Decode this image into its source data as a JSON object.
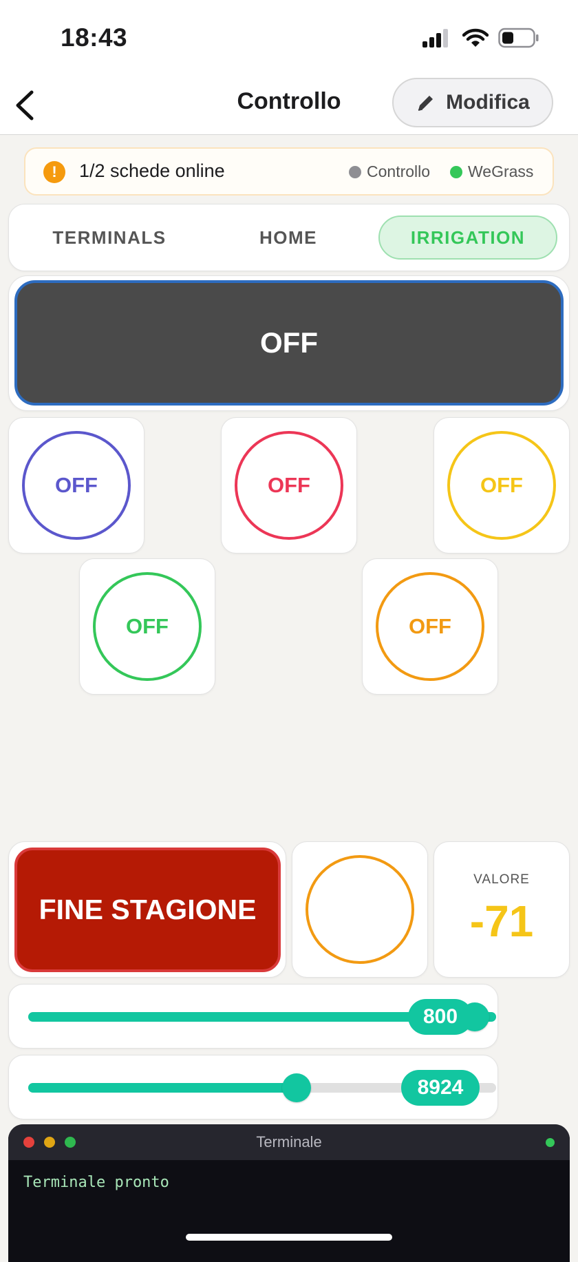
{
  "status_bar": {
    "time": "18:43",
    "signal_icon": "cellular-signal-icon",
    "wifi_icon": "wifi-icon",
    "battery_icon": "battery-icon"
  },
  "nav": {
    "title": "Controllo",
    "back_icon": "chevron-left-icon",
    "edit_label": "Modifica",
    "edit_icon": "pencil-icon"
  },
  "banner": {
    "text": "1/2 schede online",
    "icon": "warning-icon",
    "boards": [
      {
        "label": "Controllo",
        "color": "#8e8e93"
      },
      {
        "label": "WeGrass",
        "color": "#34c759"
      }
    ]
  },
  "tabs": [
    {
      "label": "TERMINALS",
      "active": false
    },
    {
      "label": "HOME",
      "active": false
    },
    {
      "label": "IRRIGATION",
      "active": true
    }
  ],
  "main_toggle": {
    "label": "OFF"
  },
  "zones": [
    {
      "label": "OFF",
      "color": "#5b57cc"
    },
    {
      "label": "OFF",
      "color": "#ec3656"
    },
    {
      "label": "OFF",
      "color": "#f5c518"
    },
    {
      "label": "OFF",
      "color": "#34c759"
    },
    {
      "label": "OFF",
      "color": "#f29a12"
    }
  ],
  "season_button": {
    "label": "FINE STAGIONE"
  },
  "indicator": {
    "color": "#f29a12"
  },
  "value_card": {
    "label": "VALORE",
    "value": "-71",
    "color": "#f5c518"
  },
  "sliders": [
    {
      "value": "800",
      "fraction": 1.0
    },
    {
      "value": "8924",
      "fraction": 0.59
    }
  ],
  "terminal": {
    "title": "Terminale",
    "text": "Terminale pronto",
    "status_color": "#34c759"
  }
}
